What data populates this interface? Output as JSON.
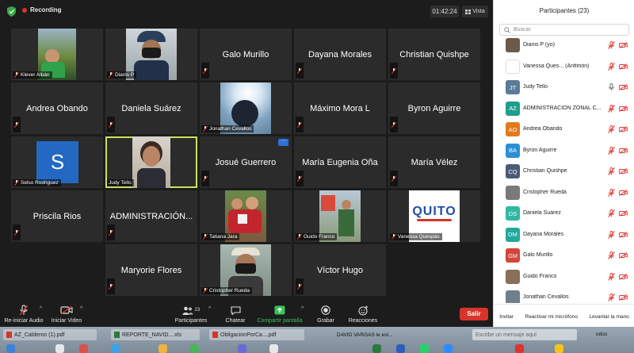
{
  "topbar": {
    "recording_label": "Recording",
    "timer": "01:42:24",
    "view_label": "Vista",
    "shield_color": "#3aa845",
    "record_color": "#e0332b"
  },
  "tiles": {
    "klever": "Klever Albán",
    "dianis": "Dianis P",
    "galo": "Galo Murillo",
    "dayana": "Dayana Morales",
    "christian": "Christian Quishpe",
    "andrea": "Andrea Obando",
    "daniela": "Daniela Suárez",
    "jonathan": "Jonathan Cevallos",
    "maximo": "Máximo Mora L",
    "byron": "Byron Aguirre",
    "selso": "Selso Rodriguez",
    "selso_initial": "S",
    "judy": "Judy Tello",
    "josue": "Josué Guerrero",
    "maria_eugenia": "María Eugenia Oña",
    "maria_velez": "María Vélez",
    "priscila": "Priscila Rios",
    "administracion": "ADMINISTRACIÓN...",
    "tatiana": "Tatiana Jara",
    "guido": "Guido Franco",
    "vanessa": "Vanessa Quespás",
    "quito_logo": "QUITO",
    "maryorie": "Maryorie Flores",
    "cristopher": "Cristopher Rueda",
    "victor": "Víctor Hugo",
    "more_label": "···",
    "active_border": "#c8e35a"
  },
  "toolbar": {
    "audio": "Re-iniciar Audio",
    "video": "Iniciar Video",
    "participants": "Participantes",
    "participants_count": "23",
    "chat": "Chatear",
    "share": "Compartir pantalla",
    "record": "Grabar",
    "reactions": "Reacciones",
    "leave": "Salir",
    "share_color": "#38c35c",
    "leave_color": "#d9342b"
  },
  "panel": {
    "title": "Participantes (23)",
    "search_placeholder": "Buscar",
    "participants": [
      {
        "name": "Dianis P (yo)",
        "initials": "",
        "color": "#6b5a4a",
        "mic": "muted"
      },
      {
        "name": "Vanessa Ques... (Anfitrión)",
        "initials": "",
        "color": "#ffffff",
        "mic": "muted"
      },
      {
        "name": "Judy Tello",
        "initials": "JT",
        "color": "#5b7b9a",
        "mic": "on"
      },
      {
        "name": "ADMINISTRACIÓN ZONAL C...",
        "initials": "AZ",
        "color": "#1e9e8c",
        "mic": "muted"
      },
      {
        "name": "Andrea Obando",
        "initials": "AO",
        "color": "#e07a1c",
        "mic": "muted"
      },
      {
        "name": "Byron Aguirre",
        "initials": "BA",
        "color": "#2b8fd6",
        "mic": "muted"
      },
      {
        "name": "Christian Quishpe",
        "initials": "CQ",
        "color": "#4a5a78",
        "mic": "muted"
      },
      {
        "name": "Cristopher Rueda",
        "initials": "",
        "color": "#7a7a7a",
        "mic": "muted"
      },
      {
        "name": "Daniela Suárez",
        "initials": "DS",
        "color": "#2fb8a0",
        "mic": "muted"
      },
      {
        "name": "Dayana Morales",
        "initials": "DM",
        "color": "#23a89a",
        "mic": "muted"
      },
      {
        "name": "Galo Murillo",
        "initials": "GM",
        "color": "#d2453a",
        "mic": "muted"
      },
      {
        "name": "Guido Franco",
        "initials": "",
        "color": "#8a6e5a",
        "mic": "muted"
      },
      {
        "name": "Jonathan Cevallos",
        "initials": "",
        "color": "#6e7f8e",
        "mic": "muted"
      }
    ],
    "footer_invite": "Invitar",
    "footer_unmute": "Reactivar mi micrófono",
    "footer_hand": "Levantar la mano",
    "muted_color": "#e0332b"
  },
  "taskbar": {
    "file1": "AZ_Calderon (1).pdf",
    "file2": "REPORTE_NAVID....xls",
    "file3": "ObligacionPorCa....pdf",
    "file4": "DAVID VARGAS le est...",
    "search_placeholder": "Escribe un mensaje aquí",
    "tray_text": "odos"
  }
}
